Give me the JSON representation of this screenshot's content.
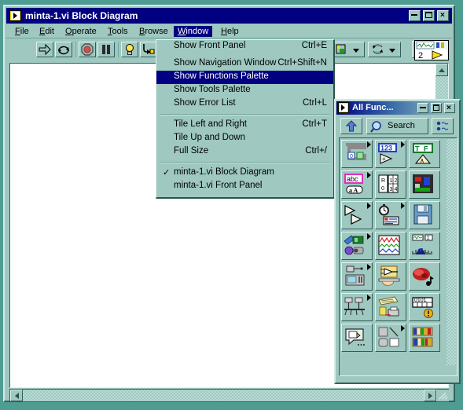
{
  "window": {
    "title": "minta-1.vi Block Diagram",
    "title_icon": "vi-block-diagram-icon",
    "buttons": {
      "minimize": "_",
      "maximize": "□",
      "close": "×"
    }
  },
  "menubar": {
    "items": [
      {
        "label": "File",
        "mnemonic": "F",
        "selected": false
      },
      {
        "label": "Edit",
        "mnemonic": "E",
        "selected": false
      },
      {
        "label": "Operate",
        "mnemonic": "O",
        "selected": false
      },
      {
        "label": "Tools",
        "mnemonic": "T",
        "selected": false
      },
      {
        "label": "Browse",
        "mnemonic": "B",
        "selected": false
      },
      {
        "label": "Window",
        "mnemonic": "W",
        "selected": true
      },
      {
        "label": "Help",
        "mnemonic": "H",
        "selected": false
      }
    ]
  },
  "toolbar": {
    "buttons": [
      {
        "name": "run-button",
        "icon": "right-arrow-icon"
      },
      {
        "name": "run-continuously-button",
        "icon": "circular-arrows-icon"
      },
      {
        "name": "abort-execution-button",
        "icon": "stop-octagon-icon"
      },
      {
        "name": "pause-button",
        "icon": "pause-bars-icon"
      },
      {
        "name": "highlight-execution-button",
        "icon": "lightbulb-icon"
      },
      {
        "name": "step-into-button",
        "icon": "step-into-icon"
      },
      {
        "name": "step-over-button",
        "icon": "step-over-icon"
      }
    ],
    "dropdowns": [
      {
        "name": "text-settings-dropdown",
        "icon": "font-box-icon"
      },
      {
        "name": "reorder-dropdown",
        "icon": "reorder-arrows-icon"
      }
    ],
    "help_button": {
      "name": "context-help-button",
      "label": "?"
    },
    "vi_icon": {
      "name": "vi-icon",
      "label": "2"
    }
  },
  "menu": {
    "name": "window-menu",
    "items": [
      {
        "label": "Show Front Panel",
        "mnemonic": "",
        "accel": "Ctrl+E",
        "highlighted": false,
        "checked": false
      },
      {
        "type": "space"
      },
      {
        "label": "Show Navigation Window",
        "mnemonic": "",
        "accel": "Ctrl+Shift+N",
        "highlighted": false,
        "checked": false
      },
      {
        "label": "Show Functions Palette",
        "mnemonic": "",
        "accel": "",
        "highlighted": true,
        "checked": false
      },
      {
        "label": "Show Tools Palette",
        "mnemonic": "P",
        "accel": "",
        "highlighted": false,
        "checked": false
      },
      {
        "label": "Show Error List",
        "mnemonic": "L",
        "accel": "Ctrl+L",
        "highlighted": false,
        "checked": false
      },
      {
        "type": "sep"
      },
      {
        "label": "Tile Left and Right",
        "mnemonic": "T",
        "accel": "Ctrl+T",
        "highlighted": false,
        "checked": false
      },
      {
        "label": "Tile Up and Down",
        "mnemonic": "U",
        "accel": "",
        "highlighted": false,
        "checked": false
      },
      {
        "label": "Full Size",
        "mnemonic": "F",
        "accel": "Ctrl+/",
        "highlighted": false,
        "checked": false
      },
      {
        "type": "sep"
      },
      {
        "label": "minta-1.vi Block Diagram",
        "mnemonic": "",
        "accel": "",
        "highlighted": false,
        "checked": true
      },
      {
        "label": "minta-1.vi Front Panel",
        "mnemonic": "",
        "accel": "",
        "highlighted": false,
        "checked": false
      }
    ],
    "check_glyph": "✓"
  },
  "palette": {
    "title": "All Func...",
    "title_icon": "vi-palette-icon",
    "buttons": {
      "minimize": "_",
      "maximize": "□",
      "close": "×"
    },
    "toolbar": {
      "up_button": {
        "name": "up-one-level-button",
        "icon": "up-arrow-icon"
      },
      "search_button": {
        "name": "search-button",
        "label": "Search",
        "icon": "magnifier-icon"
      },
      "options_button": {
        "name": "palette-options-button",
        "icon": "options-list-icon"
      }
    },
    "grid": [
      {
        "name": "structures-palette",
        "icon": "structures-icon",
        "has_submenu": true
      },
      {
        "name": "numeric-palette",
        "icon": "numeric-123-icon",
        "has_submenu": true
      },
      {
        "name": "boolean-palette",
        "icon": "boolean-tf-icon",
        "has_submenu": false
      },
      {
        "name": "string-palette",
        "icon": "string-abc-icon",
        "has_submenu": true
      },
      {
        "name": "array-cluster-palette",
        "icon": "array-cluster-icon",
        "has_submenu": false
      },
      {
        "name": "comparison-palette",
        "icon": "comparison-icon",
        "has_submenu": false
      },
      {
        "name": "time-dialog-palette",
        "icon": "double-arrow-icon",
        "has_submenu": true
      },
      {
        "name": "timing-palette",
        "icon": "clock-icon",
        "has_submenu": true
      },
      {
        "name": "file-io-palette",
        "icon": "floppy-disk-icon",
        "has_submenu": false
      },
      {
        "name": "instrument-io-palette",
        "icon": "instrument-io-icon",
        "has_submenu": true
      },
      {
        "name": "waveform-palette",
        "icon": "waveform-graph-icon",
        "has_submenu": false
      },
      {
        "name": "analyze-palette",
        "icon": "analysis-peak-icon",
        "has_submenu": false
      },
      {
        "name": "data-acquisition-palette",
        "icon": "daq-device-icon",
        "has_submenu": true
      },
      {
        "name": "instrument-drivers-palette",
        "icon": "hand-amplifier-icon",
        "has_submenu": false
      },
      {
        "name": "motion-vision-palette",
        "icon": "motion-vision-icon",
        "has_submenu": false
      },
      {
        "name": "communication-palette",
        "icon": "network-nodes-icon",
        "has_submenu": true
      },
      {
        "name": "application-control-palette",
        "icon": "printer-document-icon",
        "has_submenu": false
      },
      {
        "name": "report-generation-palette",
        "icon": "binary-warning-icon",
        "has_submenu": false
      },
      {
        "name": "select-a-vi-palette",
        "icon": "select-vi-bubble-icon",
        "has_submenu": false
      },
      {
        "name": "decorations-palette",
        "icon": "decorations-shapes-icon",
        "has_submenu": true
      },
      {
        "name": "user-libraries-palette",
        "icon": "bookshelf-icon",
        "has_submenu": false
      }
    ]
  },
  "colors": {
    "desktop": "#4f9c92",
    "window_face": "#9ec8c0",
    "titlebar": "#000080",
    "titlebar_text": "#ffffff",
    "highlight": "#000080",
    "canvas": "#ffffff",
    "bevel_light": "#e4f2ef",
    "bevel_dark": "#2f5f58"
  }
}
